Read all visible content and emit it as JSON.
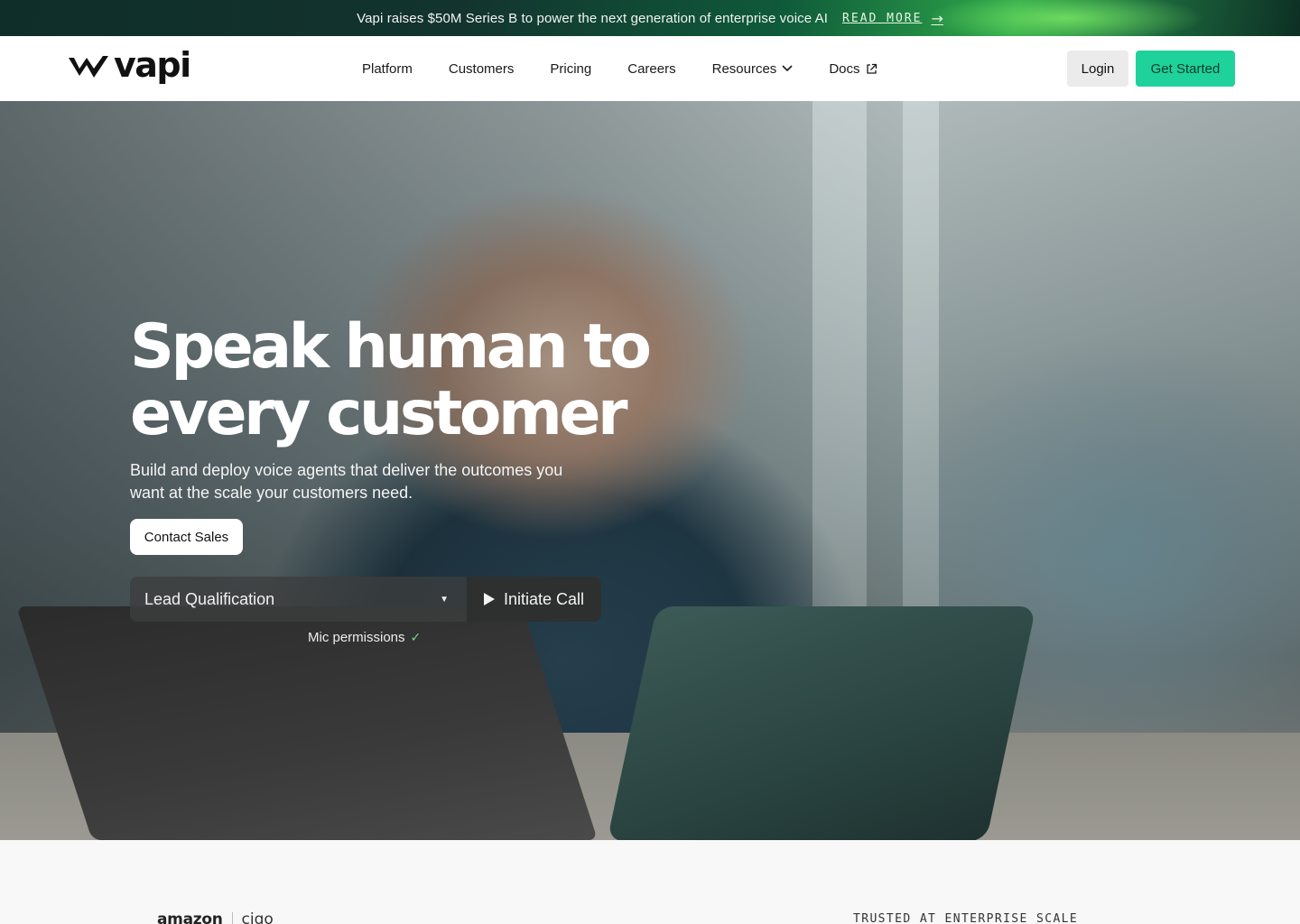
{
  "announcement": {
    "message": "Vapi raises $50M Series B to power the next generation of enterprise voice AI",
    "link_label": "READ MORE",
    "arrow_icon": "→"
  },
  "nav": {
    "logo_text": "vapi",
    "items": [
      {
        "label": "Platform"
      },
      {
        "label": "Customers"
      },
      {
        "label": "Pricing"
      },
      {
        "label": "Careers"
      },
      {
        "label": "Resources",
        "icon": "chevron-down-icon"
      },
      {
        "label": "Docs",
        "icon": "external-link-icon"
      }
    ],
    "login_label": "Login",
    "get_started_label": "Get Started"
  },
  "hero": {
    "headline_line1": "Speak human to",
    "headline_line2": "every customer",
    "subtitle": "Build and deploy voice agents that deliver the outcomes you want at the scale your customers need.",
    "contact_label": "Contact Sales",
    "call_select_value": "Lead Qualification",
    "call_button_label": "Initiate Call",
    "mic_label": "Mic permissions"
  },
  "trusted": {
    "logos": [
      "amazon",
      "cigo"
    ],
    "label": "TRUSTED AT ENTERPRISE SCALE"
  },
  "colors": {
    "accent": "#1fd19a",
    "announcement_bg": "#0f2e2a",
    "nav_bg": "#ffffff"
  }
}
